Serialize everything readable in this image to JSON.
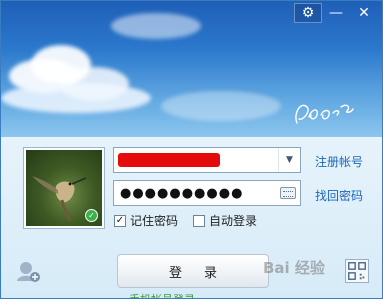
{
  "title_bar": {
    "settings_icon": "gear-icon",
    "minimize_symbol": "—",
    "close_symbol": "✕"
  },
  "account": {
    "value_redacted": true
  },
  "password": {
    "masked_value": "●●●●●●●●●●"
  },
  "links": {
    "register": "注册帐号",
    "recover": "找回密码"
  },
  "options": {
    "remember_password": {
      "label": "记住密码",
      "checked": true
    },
    "auto_login": {
      "label": "自动登录",
      "checked": false
    }
  },
  "login_button": {
    "label": "登录"
  },
  "watermark": "Bai 经验",
  "bottom_text": "手机帐号登录",
  "colors": {
    "accent": "#1b67b8",
    "sky_top": "#1f5fb7",
    "panel": "#d6ebf8",
    "status_online": "#3cb14a",
    "redaction": "#e30b0b"
  }
}
